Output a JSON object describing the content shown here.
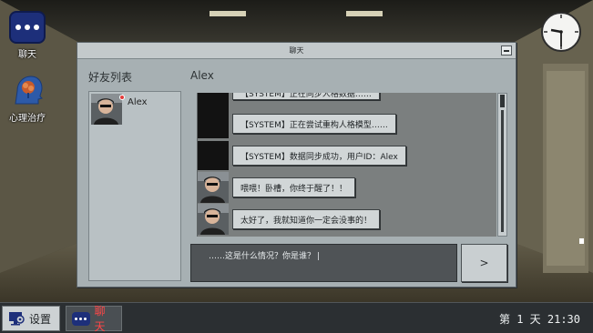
{
  "desktop": {
    "icons": [
      {
        "label": "聊天",
        "icon": "chat-bubble-icon"
      },
      {
        "label": "心理治疗",
        "icon": "brain-head-icon"
      }
    ],
    "clock_icon": "analog-clock-icon"
  },
  "window": {
    "title": "聊天",
    "friends_heading": "好友列表",
    "chat_heading": "Alex",
    "friends": [
      {
        "name": "Alex",
        "unread": true
      }
    ],
    "messages": [
      {
        "text": "【SYSTEM】正在同步人格数据……",
        "avatar": false,
        "cut": true
      },
      {
        "text": "【SYSTEM】正在尝试重构人格模型……",
        "avatar": false
      },
      {
        "text": "【SYSTEM】数据同步成功，用户ID：Alex",
        "avatar": false
      },
      {
        "text": "喂喂！卧槽，你终于醒了！！",
        "avatar": true
      },
      {
        "text": "太好了，我就知道你一定会没事的！",
        "avatar": true
      }
    ],
    "input_value": "……这是什么情况？你是谁？",
    "send_label": ">"
  },
  "taskbar": {
    "settings_label": "设置",
    "chat_label": "聊天",
    "day_time": "第 1 天  21:30"
  },
  "colors": {
    "window_bg": "#a7b0b3",
    "chat_accent": "#ff4747",
    "taskbar_bg": "#2b2f32",
    "unread_dot": "#e23b3b"
  }
}
